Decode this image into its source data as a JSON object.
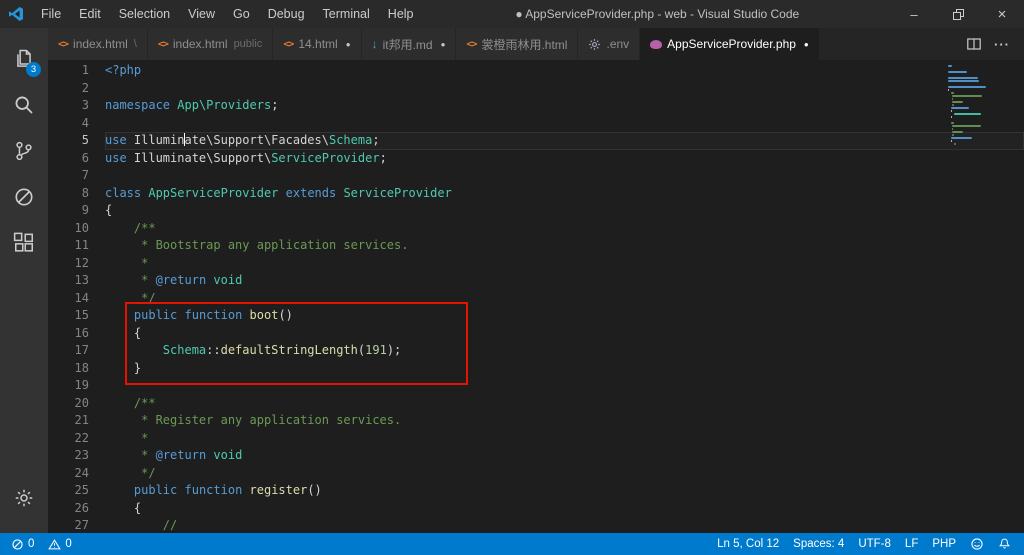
{
  "window": {
    "title": "● AppServiceProvider.php - web - Visual Studio Code",
    "menus": [
      {
        "name": "file",
        "label": "File"
      },
      {
        "name": "edit",
        "label": "Edit"
      },
      {
        "name": "selection",
        "label": "Selection"
      },
      {
        "name": "view",
        "label": "View"
      },
      {
        "name": "go",
        "label": "Go"
      },
      {
        "name": "debug",
        "label": "Debug"
      },
      {
        "name": "terminal",
        "label": "Terminal"
      },
      {
        "name": "help",
        "label": "Help"
      }
    ],
    "controls": [
      {
        "name": "minimize",
        "glyph": "–"
      },
      {
        "name": "restore",
        "glyph": ""
      },
      {
        "name": "close",
        "glyph": "×"
      }
    ]
  },
  "activity_bar": {
    "top": [
      {
        "name": "explorer",
        "icon": "explorer",
        "badge": "3"
      },
      {
        "name": "search",
        "icon": "search"
      },
      {
        "name": "source-control",
        "icon": "scm"
      },
      {
        "name": "debug",
        "icon": "debug"
      },
      {
        "name": "extensions",
        "icon": "extensions"
      }
    ],
    "bottom": [
      {
        "name": "settings",
        "icon": "gear"
      }
    ]
  },
  "tab_bar": {
    "tabs": [
      {
        "label": "index.html",
        "detail": "\\",
        "icon": "html",
        "modified": false,
        "active": false
      },
      {
        "label": "index.html",
        "detail": "public",
        "icon": "html",
        "modified": false,
        "active": false
      },
      {
        "label": "14.html",
        "icon": "html",
        "modified": true,
        "active": false
      },
      {
        "label": "it邦用.md",
        "icon": "md",
        "modified": true,
        "active": false
      },
      {
        "label": "裳橙雨林用.html",
        "icon": "html",
        "modified": false,
        "active": false
      },
      {
        "label": ".env",
        "icon": "gearfile",
        "modified": false,
        "active": false
      },
      {
        "label": "AppServiceProvider.php",
        "icon": "php",
        "modified": true,
        "active": true
      }
    ],
    "actions": [
      {
        "name": "split-editor",
        "icon": "split"
      },
      {
        "name": "more-actions",
        "icon": "more"
      }
    ]
  },
  "editor": {
    "language": "php",
    "cursor": {
      "line": 5,
      "col": 12
    },
    "colors": {
      "kw": "#569cd6",
      "type": "#4ec9b0",
      "fn": "#dcdcaa",
      "cm": "#6a9955",
      "num": "#b5cea8",
      "pl": "#d4d4d4",
      "doc": "#569cd6"
    },
    "annotation": {
      "shape": "rectangle",
      "color": "#e51400"
    },
    "lines": [
      {
        "n": 1,
        "tokens": [
          {
            "c": "kw",
            "t": "<?php"
          }
        ]
      },
      {
        "n": 2,
        "tokens": []
      },
      {
        "n": 3,
        "tokens": [
          {
            "c": "kw",
            "t": "namespace"
          },
          {
            "c": "pl",
            "t": " "
          },
          {
            "c": "type",
            "t": "App\\Providers"
          },
          {
            "c": "pl",
            "t": ";"
          }
        ]
      },
      {
        "n": 4,
        "tokens": []
      },
      {
        "n": 5,
        "current": true,
        "tokens": [
          {
            "c": "kw",
            "t": "use"
          },
          {
            "c": "pl",
            "t": " Illumin"
          },
          {
            "c": "cursor",
            "t": ""
          },
          {
            "c": "pl",
            "t": "ate\\Support\\Facades\\"
          },
          {
            "c": "type",
            "t": "Schema"
          },
          {
            "c": "pl",
            "t": ";"
          }
        ]
      },
      {
        "n": 6,
        "tokens": [
          {
            "c": "kw",
            "t": "use"
          },
          {
            "c": "pl",
            "t": " Illuminate\\Support\\"
          },
          {
            "c": "type",
            "t": "ServiceProvider"
          },
          {
            "c": "pl",
            "t": ";"
          }
        ]
      },
      {
        "n": 7,
        "tokens": []
      },
      {
        "n": 8,
        "tokens": [
          {
            "c": "kw",
            "t": "class"
          },
          {
            "c": "pl",
            "t": " "
          },
          {
            "c": "type",
            "t": "AppServiceProvider"
          },
          {
            "c": "pl",
            "t": " "
          },
          {
            "c": "kw",
            "t": "extends"
          },
          {
            "c": "pl",
            "t": " "
          },
          {
            "c": "type",
            "t": "ServiceProvider"
          }
        ]
      },
      {
        "n": 9,
        "tokens": [
          {
            "c": "pl",
            "t": "{"
          }
        ]
      },
      {
        "n": 10,
        "tokens": [
          {
            "c": "pl",
            "t": "    "
          },
          {
            "c": "cm",
            "t": "/**"
          }
        ]
      },
      {
        "n": 11,
        "tokens": [
          {
            "c": "pl",
            "t": "    "
          },
          {
            "c": "cm",
            "t": " * Bootstrap any application services."
          }
        ]
      },
      {
        "n": 12,
        "tokens": [
          {
            "c": "pl",
            "t": "    "
          },
          {
            "c": "cm",
            "t": " *"
          }
        ]
      },
      {
        "n": 13,
        "tokens": [
          {
            "c": "pl",
            "t": "    "
          },
          {
            "c": "cm",
            "t": " * "
          },
          {
            "c": "doc",
            "t": "@return"
          },
          {
            "c": "cm",
            "t": " "
          },
          {
            "c": "type",
            "t": "void"
          }
        ]
      },
      {
        "n": 14,
        "tokens": [
          {
            "c": "pl",
            "t": "    "
          },
          {
            "c": "cm",
            "t": " */"
          }
        ]
      },
      {
        "n": 15,
        "tokens": [
          {
            "c": "pl",
            "t": "    "
          },
          {
            "c": "kw",
            "t": "public"
          },
          {
            "c": "pl",
            "t": " "
          },
          {
            "c": "kw",
            "t": "function"
          },
          {
            "c": "pl",
            "t": " "
          },
          {
            "c": "fn",
            "t": "boot"
          },
          {
            "c": "pl",
            "t": "()"
          }
        ]
      },
      {
        "n": 16,
        "tokens": [
          {
            "c": "pl",
            "t": "    {"
          }
        ]
      },
      {
        "n": 17,
        "tokens": [
          {
            "c": "pl",
            "t": "        "
          },
          {
            "c": "type",
            "t": "Schema"
          },
          {
            "c": "pl",
            "t": "::"
          },
          {
            "c": "fn",
            "t": "defaultStringLength"
          },
          {
            "c": "pl",
            "t": "("
          },
          {
            "c": "num",
            "t": "191"
          },
          {
            "c": "pl",
            "t": ");"
          }
        ]
      },
      {
        "n": 18,
        "tokens": [
          {
            "c": "pl",
            "t": "    }"
          }
        ]
      },
      {
        "n": 19,
        "tokens": []
      },
      {
        "n": 20,
        "tokens": [
          {
            "c": "pl",
            "t": "    "
          },
          {
            "c": "cm",
            "t": "/**"
          }
        ]
      },
      {
        "n": 21,
        "tokens": [
          {
            "c": "pl",
            "t": "    "
          },
          {
            "c": "cm",
            "t": " * Register any application services."
          }
        ]
      },
      {
        "n": 22,
        "tokens": [
          {
            "c": "pl",
            "t": "    "
          },
          {
            "c": "cm",
            "t": " *"
          }
        ]
      },
      {
        "n": 23,
        "tokens": [
          {
            "c": "pl",
            "t": "    "
          },
          {
            "c": "cm",
            "t": " * "
          },
          {
            "c": "doc",
            "t": "@return"
          },
          {
            "c": "cm",
            "t": " "
          },
          {
            "c": "type",
            "t": "void"
          }
        ]
      },
      {
        "n": 24,
        "tokens": [
          {
            "c": "pl",
            "t": "    "
          },
          {
            "c": "cm",
            "t": " */"
          }
        ]
      },
      {
        "n": 25,
        "tokens": [
          {
            "c": "pl",
            "t": "    "
          },
          {
            "c": "kw",
            "t": "public"
          },
          {
            "c": "pl",
            "t": " "
          },
          {
            "c": "kw",
            "t": "function"
          },
          {
            "c": "pl",
            "t": " "
          },
          {
            "c": "fn",
            "t": "register"
          },
          {
            "c": "pl",
            "t": "()"
          }
        ]
      },
      {
        "n": 26,
        "tokens": [
          {
            "c": "pl",
            "t": "    {"
          }
        ]
      },
      {
        "n": 27,
        "tokens": [
          {
            "c": "pl",
            "t": "        "
          },
          {
            "c": "cm",
            "t": "//"
          }
        ]
      }
    ]
  },
  "status_bar": {
    "background": "#007acc",
    "left": [
      {
        "name": "errors",
        "icon": "error",
        "text": "0"
      },
      {
        "name": "warnings",
        "icon": "warning",
        "text": "0"
      }
    ],
    "right": [
      {
        "name": "cursor-position",
        "text": "Ln 5, Col 12"
      },
      {
        "name": "indentation",
        "text": "Spaces: 4"
      },
      {
        "name": "encoding",
        "text": "UTF-8"
      },
      {
        "name": "eol",
        "text": "LF"
      },
      {
        "name": "language-mode",
        "text": "PHP"
      },
      {
        "name": "feedback",
        "icon": "smiley"
      },
      {
        "name": "notifications",
        "icon": "bell"
      }
    ]
  }
}
